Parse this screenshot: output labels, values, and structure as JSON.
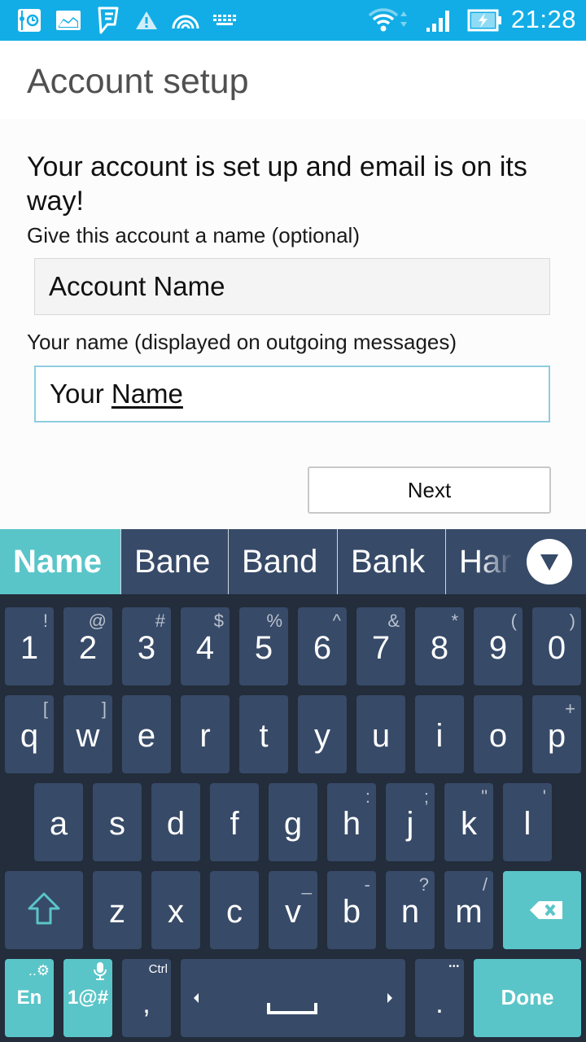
{
  "status_bar": {
    "left_icons": [
      "timer-app-icon",
      "gallery-icon",
      "foursquare-icon",
      "warning-icon",
      "hotspot-icon",
      "keyboard-icon"
    ],
    "right_icons": [
      "wifi-icon",
      "signal-icon",
      "battery-charging-icon"
    ],
    "time": "21:28",
    "background_color": "#12ade6"
  },
  "header": {
    "title": "Account setup"
  },
  "form": {
    "headline": "Your account is set up and email is on its way!",
    "account_name_label": "Give this account a name (optional)",
    "account_name_value": "Account Name",
    "your_name_label": "Your name (displayed on outgoing messages)",
    "your_name_value_prefix": "Your ",
    "your_name_value_composing": "Name",
    "next_button": "Next"
  },
  "keyboard": {
    "accent_color": "#5ac5c8",
    "key_color": "#374a68",
    "background_color": "#232d3b",
    "suggestions": [
      "Name",
      "Bane",
      "Band",
      "Bank",
      "Har"
    ],
    "expand_icon": "triangle-down-icon",
    "rows": [
      [
        {
          "k": "1",
          "s": "!"
        },
        {
          "k": "2",
          "s": "@"
        },
        {
          "k": "3",
          "s": "#"
        },
        {
          "k": "4",
          "s": "$"
        },
        {
          "k": "5",
          "s": "%"
        },
        {
          "k": "6",
          "s": "^"
        },
        {
          "k": "7",
          "s": "&"
        },
        {
          "k": "8",
          "s": "*"
        },
        {
          "k": "9",
          "s": "("
        },
        {
          "k": "0",
          "s": ")"
        }
      ],
      [
        {
          "k": "q",
          "s": "["
        },
        {
          "k": "w",
          "s": "]"
        },
        {
          "k": "e",
          "s": ""
        },
        {
          "k": "r",
          "s": ""
        },
        {
          "k": "t",
          "s": ""
        },
        {
          "k": "y",
          "s": ""
        },
        {
          "k": "u",
          "s": ""
        },
        {
          "k": "i",
          "s": ""
        },
        {
          "k": "o",
          "s": ""
        },
        {
          "k": "p",
          "s": "+"
        }
      ],
      [
        {
          "k": "a",
          "s": ""
        },
        {
          "k": "s",
          "s": ""
        },
        {
          "k": "d",
          "s": ""
        },
        {
          "k": "f",
          "s": ""
        },
        {
          "k": "g",
          "s": ""
        },
        {
          "k": "h",
          "s": ":"
        },
        {
          "k": "j",
          "s": ";"
        },
        {
          "k": "k",
          "s": "\""
        },
        {
          "k": "l",
          "s": "'"
        }
      ],
      [
        {
          "k": "z",
          "s": ""
        },
        {
          "k": "x",
          "s": ""
        },
        {
          "k": "c",
          "s": ""
        },
        {
          "k": "v",
          "s": "_"
        },
        {
          "k": "b",
          "s": "-"
        },
        {
          "k": "n",
          "s": "?"
        },
        {
          "k": "m",
          "s": "/"
        }
      ]
    ],
    "lang_key": "En",
    "lang_key_sup": "..⚙",
    "symbols_key": "1@#",
    "comma_key": ",",
    "comma_key_sup": "Ctrl",
    "period_key": ".",
    "period_key_sup": "•••",
    "done_key": "Done"
  }
}
